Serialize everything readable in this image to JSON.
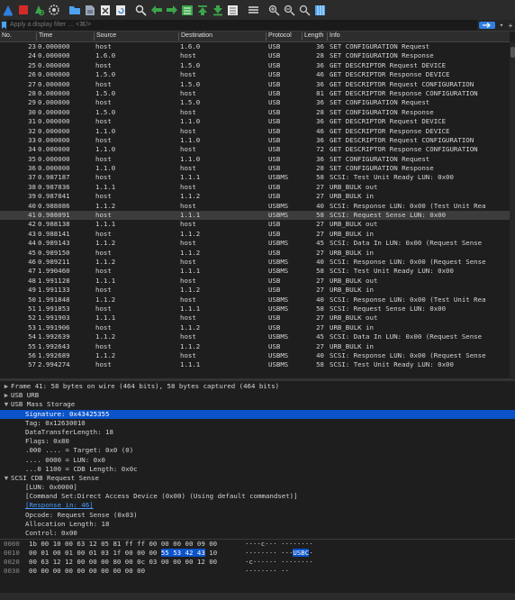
{
  "toolbar": {
    "icons": [
      "shark-fin-icon",
      "stop-icon",
      "restart-icon",
      "options-gear-icon",
      "open-folder-icon",
      "save-file-icon",
      "close-file-icon",
      "reload-icon",
      "find-icon",
      "go-back-icon",
      "go-forward-icon",
      "go-to-packet-icon",
      "go-first-icon",
      "go-last-icon",
      "auto-scroll-icon",
      "colorize-icon",
      "zoom-in-icon",
      "zoom-out-icon",
      "zoom-normal-icon",
      "resize-columns-icon"
    ]
  },
  "filter": {
    "placeholder": "Apply a display filter … <⌘/>"
  },
  "columns": {
    "no": "No.",
    "time": "Time",
    "source": "Source",
    "destination": "Destination",
    "protocol": "Protocol",
    "length": "Length",
    "info": "Info"
  },
  "packets": [
    {
      "no": "23",
      "time": "0.000000",
      "src": "host",
      "dst": "1.6.0",
      "proto": "USB",
      "len": "36",
      "info": "SET CONFIGURATION Request"
    },
    {
      "no": "24",
      "time": "0.000000",
      "src": "1.6.0",
      "dst": "host",
      "proto": "USB",
      "len": "28",
      "info": "SET CONFIGURATION Response"
    },
    {
      "no": "25",
      "time": "0.000000",
      "src": "host",
      "dst": "1.5.0",
      "proto": "USB",
      "len": "36",
      "info": "GET DESCRIPTOR Request DEVICE"
    },
    {
      "no": "26",
      "time": "0.000000",
      "src": "1.5.0",
      "dst": "host",
      "proto": "USB",
      "len": "46",
      "info": "GET DESCRIPTOR Response DEVICE"
    },
    {
      "no": "27",
      "time": "0.000000",
      "src": "host",
      "dst": "1.5.0",
      "proto": "USB",
      "len": "36",
      "info": "GET DESCRIPTOR Request CONFIGURATION"
    },
    {
      "no": "28",
      "time": "0.000000",
      "src": "1.5.0",
      "dst": "host",
      "proto": "USB",
      "len": "81",
      "info": "GET DESCRIPTOR Response CONFIGURATION"
    },
    {
      "no": "29",
      "time": "0.000000",
      "src": "host",
      "dst": "1.5.0",
      "proto": "USB",
      "len": "36",
      "info": "SET CONFIGURATION Request"
    },
    {
      "no": "30",
      "time": "0.000000",
      "src": "1.5.0",
      "dst": "host",
      "proto": "USB",
      "len": "28",
      "info": "SET CONFIGURATION Response"
    },
    {
      "no": "31",
      "time": "0.000000",
      "src": "host",
      "dst": "1.1.0",
      "proto": "USB",
      "len": "36",
      "info": "GET DESCRIPTOR Request DEVICE"
    },
    {
      "no": "32",
      "time": "0.000000",
      "src": "1.1.0",
      "dst": "host",
      "proto": "USB",
      "len": "46",
      "info": "GET DESCRIPTOR Response DEVICE"
    },
    {
      "no": "33",
      "time": "0.000000",
      "src": "host",
      "dst": "1.1.0",
      "proto": "USB",
      "len": "36",
      "info": "GET DESCRIPTOR Request CONFIGURATION"
    },
    {
      "no": "34",
      "time": "0.000000",
      "src": "1.1.0",
      "dst": "host",
      "proto": "USB",
      "len": "72",
      "info": "GET DESCRIPTOR Response CONFIGURATION"
    },
    {
      "no": "35",
      "time": "0.000000",
      "src": "host",
      "dst": "1.1.0",
      "proto": "USB",
      "len": "36",
      "info": "SET CONFIGURATION Request"
    },
    {
      "no": "36",
      "time": "0.000000",
      "src": "1.1.0",
      "dst": "host",
      "proto": "USB",
      "len": "28",
      "info": "SET CONFIGURATION Response"
    },
    {
      "no": "37",
      "time": "0.987187",
      "src": "host",
      "dst": "1.1.1",
      "proto": "USBMS",
      "len": "58",
      "info": "SCSI: Test Unit Ready LUN: 0x00"
    },
    {
      "no": "38",
      "time": "0.987836",
      "src": "1.1.1",
      "dst": "host",
      "proto": "USB",
      "len": "27",
      "info": "URB_BULK out"
    },
    {
      "no": "39",
      "time": "0.987841",
      "src": "host",
      "dst": "1.1.2",
      "proto": "USB",
      "len": "27",
      "info": "URB_BULK in"
    },
    {
      "no": "40",
      "time": "0.988086",
      "src": "1.1.2",
      "dst": "host",
      "proto": "USBMS",
      "len": "40",
      "info": "SCSI: Response LUN: 0x00 (Test Unit Rea"
    },
    {
      "no": "41",
      "time": "0.988091",
      "src": "host",
      "dst": "1.1.1",
      "proto": "USBMS",
      "len": "58",
      "info": "SCSI: Request Sense LUN: 0x00",
      "sel": true
    },
    {
      "no": "42",
      "time": "0.988138",
      "src": "1.1.1",
      "dst": "host",
      "proto": "USB",
      "len": "27",
      "info": "URB_BULK out"
    },
    {
      "no": "43",
      "time": "0.988141",
      "src": "host",
      "dst": "1.1.2",
      "proto": "USB",
      "len": "27",
      "info": "URB_BULK in"
    },
    {
      "no": "44",
      "time": "0.989143",
      "src": "1.1.2",
      "dst": "host",
      "proto": "USBMS",
      "len": "45",
      "info": "SCSI: Data In LUN: 0x00 (Request Sense"
    },
    {
      "no": "45",
      "time": "0.989150",
      "src": "host",
      "dst": "1.1.2",
      "proto": "USB",
      "len": "27",
      "info": "URB_BULK in"
    },
    {
      "no": "46",
      "time": "0.989211",
      "src": "1.1.2",
      "dst": "host",
      "proto": "USBMS",
      "len": "40",
      "info": "SCSI: Response LUN: 0x00 (Request Sense"
    },
    {
      "no": "47",
      "time": "1.990460",
      "src": "host",
      "dst": "1.1.1",
      "proto": "USBMS",
      "len": "58",
      "info": "SCSI: Test Unit Ready LUN: 0x00"
    },
    {
      "no": "48",
      "time": "1.991128",
      "src": "1.1.1",
      "dst": "host",
      "proto": "USB",
      "len": "27",
      "info": "URB_BULK out"
    },
    {
      "no": "49",
      "time": "1.991133",
      "src": "host",
      "dst": "1.1.2",
      "proto": "USB",
      "len": "27",
      "info": "URB_BULK in"
    },
    {
      "no": "50",
      "time": "1.991848",
      "src": "1.1.2",
      "dst": "host",
      "proto": "USBMS",
      "len": "40",
      "info": "SCSI: Response LUN: 0x00 (Test Unit Rea"
    },
    {
      "no": "51",
      "time": "1.991853",
      "src": "host",
      "dst": "1.1.1",
      "proto": "USBMS",
      "len": "58",
      "info": "SCSI: Request Sense LUN: 0x00"
    },
    {
      "no": "52",
      "time": "1.991903",
      "src": "1.1.1",
      "dst": "host",
      "proto": "USB",
      "len": "27",
      "info": "URB_BULK out"
    },
    {
      "no": "53",
      "time": "1.991906",
      "src": "host",
      "dst": "1.1.2",
      "proto": "USB",
      "len": "27",
      "info": "URB_BULK in"
    },
    {
      "no": "54",
      "time": "1.992639",
      "src": "1.1.2",
      "dst": "host",
      "proto": "USBMS",
      "len": "45",
      "info": "SCSI: Data In LUN: 0x00 (Request Sense"
    },
    {
      "no": "55",
      "time": "1.992643",
      "src": "host",
      "dst": "1.1.2",
      "proto": "USB",
      "len": "27",
      "info": "URB_BULK in"
    },
    {
      "no": "56",
      "time": "1.992689",
      "src": "1.1.2",
      "dst": "host",
      "proto": "USBMS",
      "len": "40",
      "info": "SCSI: Response LUN: 0x00 (Request Sense"
    },
    {
      "no": "57",
      "time": "2.994274",
      "src": "host",
      "dst": "1.1.1",
      "proto": "USBMS",
      "len": "58",
      "info": "SCSI: Test Unit Ready LUN: 0x00"
    }
  ],
  "details": [
    {
      "arrow": "▶",
      "indent": 0,
      "text": "Frame 41: 58 bytes on wire (464 bits), 58 bytes captured (464 bits)"
    },
    {
      "arrow": "▶",
      "indent": 0,
      "text": "USB URB"
    },
    {
      "arrow": "▼",
      "indent": 0,
      "text": "USB Mass Storage"
    },
    {
      "arrow": "",
      "indent": 1,
      "text": "Signature: 0x43425355",
      "sel": true
    },
    {
      "arrow": "",
      "indent": 1,
      "text": "Tag: 0x12630010"
    },
    {
      "arrow": "",
      "indent": 1,
      "text": "DataTransferLength: 18"
    },
    {
      "arrow": "",
      "indent": 1,
      "text": "Flags: 0x80"
    },
    {
      "arrow": "",
      "indent": 1,
      "text": ".000 .... = Target: 0x0 (0)"
    },
    {
      "arrow": "",
      "indent": 1,
      "text": ".... 0000 = LUN: 0x0"
    },
    {
      "arrow": "",
      "indent": 1,
      "text": "...0 1100 = CDB Length: 0x0c"
    },
    {
      "arrow": "▼",
      "indent": 0,
      "text": "SCSI CDB Request Sense"
    },
    {
      "arrow": "",
      "indent": 1,
      "text": "[LUN: 0x0000]"
    },
    {
      "arrow": "",
      "indent": 1,
      "text": "[Command Set:Direct Access Device (0x00) (Using default commandset)]"
    },
    {
      "arrow": "",
      "indent": 1,
      "text": "[Response in: 46]",
      "link": true
    },
    {
      "arrow": "",
      "indent": 1,
      "text": "Opcode: Request Sense (0x03)"
    },
    {
      "arrow": "",
      "indent": 1,
      "text": "Allocation Length: 18"
    },
    {
      "arrow": "",
      "indent": 1,
      "text": "Control: 0x00"
    }
  ],
  "hex": [
    {
      "off": "0000",
      "pre": "1b 00 10 00 63 12 05 81  ff ff 00 00 00 00 09 00",
      "hl": "",
      "post": "",
      "ascii_pre": "····c···  ········",
      "ascii_hl": "",
      "ascii_post": ""
    },
    {
      "off": "0010",
      "pre": "00 01 00 01 00 01 03 1f  00 00 00 ",
      "hl": "55 53 42 43",
      "post": " 10",
      "ascii_pre": "········  ···",
      "ascii_hl": "USBC",
      "ascii_post": "·"
    },
    {
      "off": "0020",
      "pre": "00 63 12 12 00 00 00 80  00 0c 03 00 00 00 12 00",
      "hl": "",
      "post": "",
      "ascii_pre": "·c······  ········",
      "ascii_hl": "",
      "ascii_post": ""
    },
    {
      "off": "0030",
      "pre": "00 00 00 00 00 00 00 00  00 00",
      "hl": "",
      "post": "",
      "ascii_pre": "········  ··",
      "ascii_hl": "",
      "ascii_post": ""
    }
  ]
}
